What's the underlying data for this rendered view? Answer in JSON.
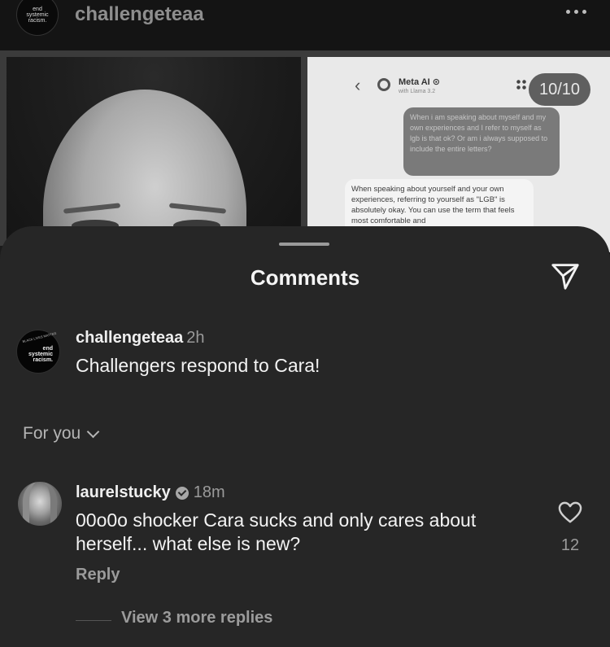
{
  "post": {
    "username": "challengeteaa",
    "avatar_text": [
      "end",
      "systemic",
      "racism."
    ],
    "carousel_counter": "10/10",
    "chat": {
      "title": "Meta AI ⊙",
      "subtitle": "with Llama 3.2",
      "user_message": "When i am speaking about myself and my own experiences and I refer to myself as lgb is that ok? Or am i always supposed to include the entire letters?",
      "ai_message": "When speaking about yourself and your own experiences, referring to yourself as \"LGB\" is absolutely okay. You can use the term that feels most comfortable and"
    }
  },
  "sheet": {
    "title": "Comments",
    "caption": {
      "username": "challengeteaa",
      "time": "2h",
      "text": "Challengers respond to Cara!",
      "avatar_small": "BLACK LIVES MATTER",
      "avatar_text": [
        "end",
        "systemic",
        "racism."
      ]
    },
    "sort_label": "For you",
    "comment": {
      "username": "laurelstucky",
      "time": "18m",
      "text": "00o0o shocker Cara sucks and only cares about herself... what else is new?",
      "reply_label": "Reply",
      "like_count": "12",
      "view_replies": "View 3 more replies"
    }
  },
  "icons": {
    "more": "more-horizontal-icon",
    "share": "paper-plane-icon",
    "heart": "heart-outline-icon",
    "chevron": "chevron-down-icon",
    "verified": "verified-badge-icon"
  }
}
